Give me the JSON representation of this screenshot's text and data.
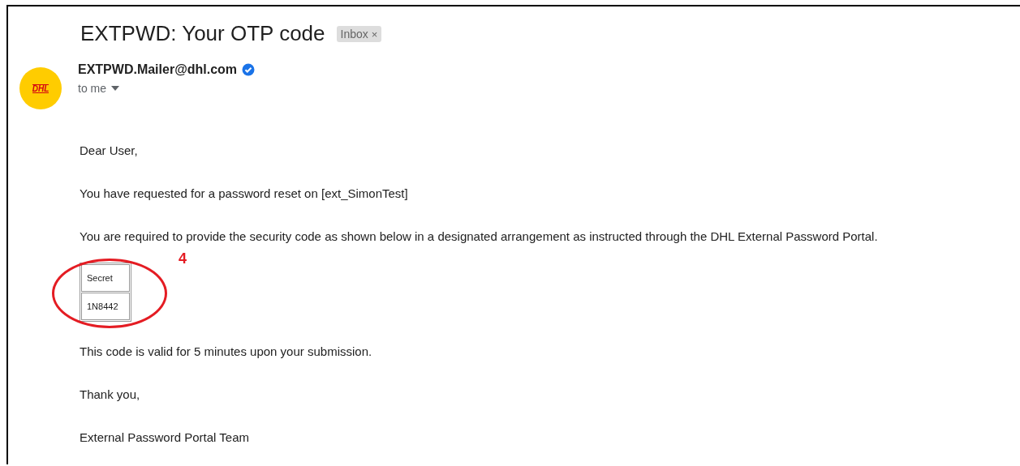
{
  "email": {
    "subject": "EXTPWD: Your OTP code",
    "label": {
      "text": "Inbox",
      "close": "×"
    },
    "sender": {
      "avatar_text": "DHL",
      "address": "EXTPWD.Mailer@dhl.com",
      "verified": true,
      "recipient": "to me"
    },
    "body_before": [
      "Dear User,",
      "You have requested for a password reset on [ext_SimonTest]",
      "You are required to provide the security code as shown below in a designated arrangement as instructed through the DHL External Password Portal."
    ],
    "code_table": [
      "Secret",
      "1N8442"
    ],
    "annotation": {
      "label": "4"
    },
    "body_after": [
      "This code is valid for 5 minutes upon your submission.",
      "Thank you,",
      "External Password Portal Team"
    ]
  }
}
